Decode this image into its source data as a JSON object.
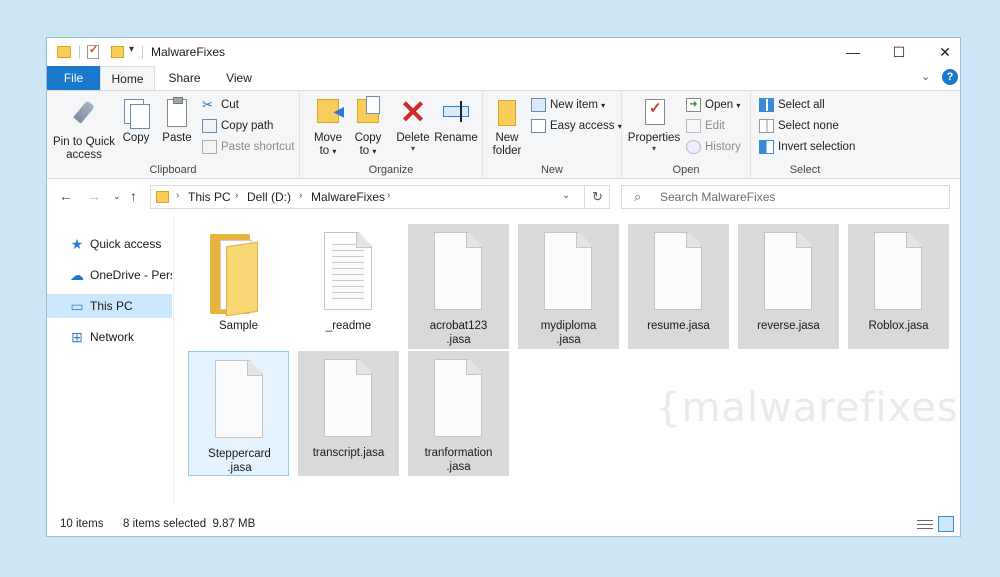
{
  "window": {
    "title": "MalwareFixes",
    "controls": {
      "minimize": "—",
      "maximize": "☐",
      "close": "✕"
    }
  },
  "ribbon_tabs": [
    "File",
    "Home",
    "Share",
    "View"
  ],
  "ribbon": {
    "clipboard": {
      "label": "Clipboard",
      "pin": "Pin to Quick access",
      "pin_line1": "Pin to Quick",
      "pin_line2": "access",
      "copy": "Copy",
      "paste": "Paste",
      "cut": "Cut",
      "copy_path": "Copy path",
      "paste_shortcut": "Paste shortcut"
    },
    "organize": {
      "label": "Organize",
      "move_to_1": "Move",
      "move_to_2": "to",
      "copy_to_1": "Copy",
      "copy_to_2": "to",
      "delete": "Delete",
      "rename": "Rename"
    },
    "new": {
      "label": "New",
      "new_folder_1": "New",
      "new_folder_2": "folder",
      "new_item": "New item",
      "easy_access": "Easy access"
    },
    "open": {
      "label": "Open",
      "properties": "Properties",
      "open": "Open",
      "edit": "Edit",
      "history": "History"
    },
    "select": {
      "label": "Select",
      "select_all": "Select all",
      "select_none": "Select none",
      "invert": "Invert selection"
    }
  },
  "address": {
    "crumbs": [
      "This PC",
      "Dell (D:)",
      "MalwareFixes"
    ],
    "search_placeholder": "Search MalwareFixes"
  },
  "sidebar": {
    "items": [
      {
        "label": "Quick access",
        "icon": "star-icon"
      },
      {
        "label": "OneDrive - Personal",
        "icon": "cloud-icon"
      },
      {
        "label": "This PC",
        "icon": "computer-icon"
      },
      {
        "label": "Network",
        "icon": "network-icon"
      }
    ]
  },
  "files": [
    {
      "name": "Sample",
      "type": "folder",
      "selected": false
    },
    {
      "name": "_readme",
      "type": "text",
      "selected": false
    },
    {
      "name": "acrobat123.jasa",
      "l1": "acrobat123",
      "l2": ".jasa",
      "type": "file",
      "selected": true
    },
    {
      "name": "mydiploma.jasa",
      "l1": "mydiploma",
      "l2": ".jasa",
      "type": "file",
      "selected": true
    },
    {
      "name": "resume.jasa",
      "type": "file",
      "selected": true
    },
    {
      "name": "reverse.jasa",
      "type": "file",
      "selected": true
    },
    {
      "name": "Roblox.jasa",
      "type": "file",
      "selected": true
    },
    {
      "name": "Steppercard.jasa",
      "l1": "Steppercard",
      "l2": ".jasa",
      "type": "file",
      "selected": true
    },
    {
      "name": "transcript.jasa",
      "type": "file",
      "selected": true
    },
    {
      "name": "tranformation.jasa",
      "l1": "tranformation",
      "l2": ".jasa",
      "type": "file",
      "selected": true
    }
  ],
  "watermark": "{malwarefixes}",
  "status": {
    "item_count": "10 items",
    "selection": "8 items selected  9.87 MB"
  }
}
